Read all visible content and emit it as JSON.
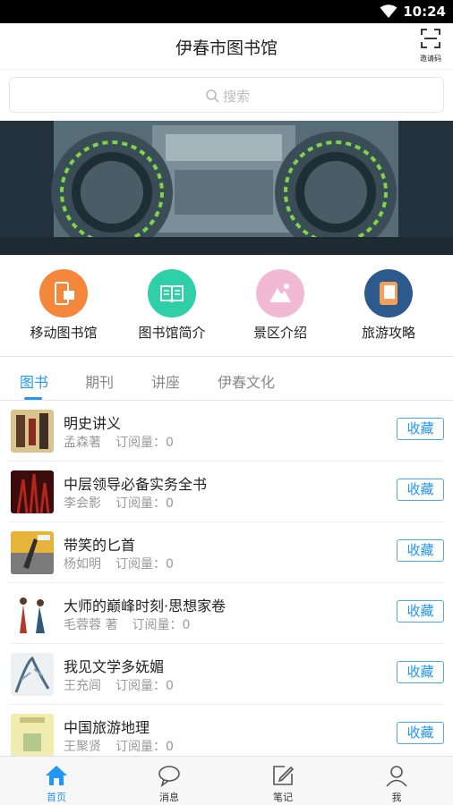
{
  "status_bar": {
    "time": "10:24"
  },
  "header": {
    "title": "伊春市图书馆",
    "scan_label": "邀请码"
  },
  "search": {
    "placeholder": "搜索"
  },
  "quick_links": [
    {
      "label": "移动图书馆",
      "color": "#f4873a",
      "icon": "mobile-book-icon"
    },
    {
      "label": "图书馆简介",
      "color": "#2fcfa8",
      "icon": "open-book-icon"
    },
    {
      "label": "景区介绍",
      "color": "#f2b9d4",
      "icon": "mountain-icon"
    },
    {
      "label": "旅游攻略",
      "color": "#2d5a8c",
      "icon": "notebook-icon"
    }
  ],
  "tabs": [
    {
      "label": "图书",
      "active": true
    },
    {
      "label": "期刊",
      "active": false
    },
    {
      "label": "讲座",
      "active": false
    },
    {
      "label": "伊春文化",
      "active": false
    }
  ],
  "books": [
    {
      "title": "明史讲义",
      "author": "孟森著",
      "subscriptions": "订阅量：0",
      "action": "收藏"
    },
    {
      "title": "中层领导必备实务全书",
      "author": "李会影",
      "subscriptions": "订阅量：0",
      "action": "收藏"
    },
    {
      "title": "带笑的匕首",
      "author": "杨如明",
      "subscriptions": "订阅量：0",
      "action": "收藏"
    },
    {
      "title": "大师的巅峰时刻·思想家卷",
      "author": "毛蓉蓉 著",
      "subscriptions": "订阅量：0",
      "action": "收藏"
    },
    {
      "title": "我见文学多妩媚",
      "author": "王充闾",
      "subscriptions": "订阅量：0",
      "action": "收藏"
    },
    {
      "title": "中国旅游地理",
      "author": "王聚贤",
      "subscriptions": "订阅量：0",
      "action": "收藏"
    }
  ],
  "bottom_nav": [
    {
      "label": "首页",
      "icon": "home-icon",
      "active": true
    },
    {
      "label": "消息",
      "icon": "message-icon",
      "active": false
    },
    {
      "label": "笔记",
      "icon": "note-icon",
      "active": false
    },
    {
      "label": "我",
      "icon": "user-icon",
      "active": false
    }
  ],
  "colors": {
    "accent": "#2196f3",
    "status_bar": "#000000"
  }
}
